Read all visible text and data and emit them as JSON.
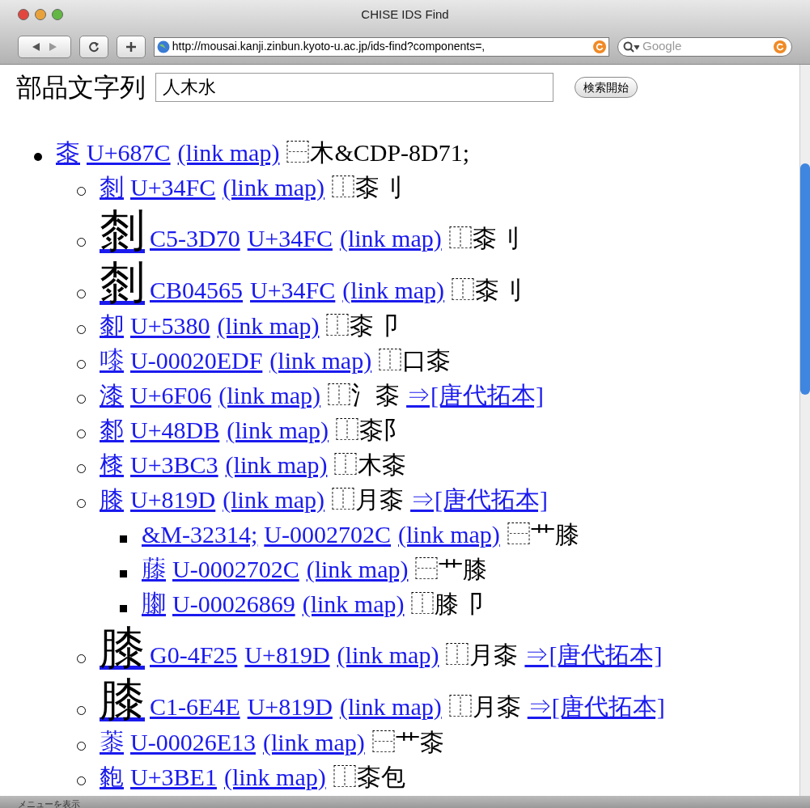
{
  "window": {
    "title": "CHISE IDS Find"
  },
  "toolbar": {
    "url": "http://mousai.kanji.zinbun.kyoto-u.ac.jp/ids-find?components=,",
    "search_placeholder": "Google"
  },
  "form": {
    "label": "部品文字列",
    "value": "人木水",
    "button": "検索開始"
  },
  "results": [
    {
      "kind": "character",
      "char": "桼",
      "codes": [
        "U+687C"
      ],
      "map_link": "(link map)",
      "ids": "⿱木&CDP-8D71;",
      "children": [
        {
          "kind": "character",
          "char": "㓼",
          "codes": [
            "U+34FC"
          ],
          "map_link": "(link map)",
          "ids": "⿰桼刂"
        },
        {
          "kind": "glyph-image",
          "char": "㓼",
          "codes": [
            "C5-3D70",
            "U+34FC"
          ],
          "map_link": "(link map)",
          "ids": "⿰桼刂"
        },
        {
          "kind": "glyph-image",
          "char": "㓼",
          "codes": [
            "CB04565",
            "U+34FC"
          ],
          "map_link": "(link map)",
          "ids": "⿰桼刂"
        },
        {
          "kind": "character",
          "char": "厀",
          "codes": [
            "U+5380"
          ],
          "map_link": "(link map)",
          "ids": "⿰桼卩"
        },
        {
          "kind": "character",
          "char": "𠻟",
          "codes": [
            "U-00020EDF"
          ],
          "map_link": "(link map)",
          "ids": "⿰口桼"
        },
        {
          "kind": "character",
          "char": "漆",
          "codes": [
            "U+6F06"
          ],
          "map_link": "(link map)",
          "ids": "⿰氵桼",
          "extra_link": "⇒[唐代拓本]"
        },
        {
          "kind": "character",
          "char": "䣛",
          "codes": [
            "U+48DB"
          ],
          "map_link": "(link map)",
          "ids": "⿰桼阝"
        },
        {
          "kind": "character",
          "char": "㯃",
          "codes": [
            "U+3BC3"
          ],
          "map_link": "(link map)",
          "ids": "⿰木桼"
        },
        {
          "kind": "character",
          "char": "膝",
          "codes": [
            "U+819D"
          ],
          "map_link": "(link map)",
          "ids": "⿰月桼",
          "extra_link": "⇒[唐代拓本]",
          "children": [
            {
              "kind": "character",
              "char": "&M-32314;",
              "codes": [
                "U-0002702C"
              ],
              "map_link": "(link map)",
              "ids": "⿱艹膝"
            },
            {
              "kind": "character",
              "char": "𧀬",
              "codes": [
                "U-0002702C"
              ],
              "map_link": "(link map)",
              "ids": "⿱艹膝"
            },
            {
              "kind": "character",
              "char": "𦡩",
              "codes": [
                "U-00026869"
              ],
              "map_link": "(link map)",
              "ids": "⿰膝卩"
            }
          ]
        },
        {
          "kind": "glyph-image",
          "char": "膝",
          "codes": [
            "G0-4F25",
            "U+819D"
          ],
          "map_link": "(link map)",
          "ids": "⿰月桼",
          "extra_link": "⇒[唐代拓本]"
        },
        {
          "kind": "glyph-image",
          "char": "膝",
          "codes": [
            "C1-6E4E",
            "U+819D"
          ],
          "map_link": "(link map)",
          "ids": "⿰月桼",
          "extra_link": "⇒[唐代拓本]"
        },
        {
          "kind": "character",
          "char": "𦸓",
          "codes": [
            "U-00026E13"
          ],
          "map_link": "(link map)",
          "ids": "⿱艹桼"
        },
        {
          "kind": "character",
          "char": "㯡",
          "codes": [
            "U+3BE1"
          ],
          "map_link": "(link map)",
          "ids": "⿰桼包"
        }
      ]
    }
  ],
  "status_bar": "メニューを表示"
}
